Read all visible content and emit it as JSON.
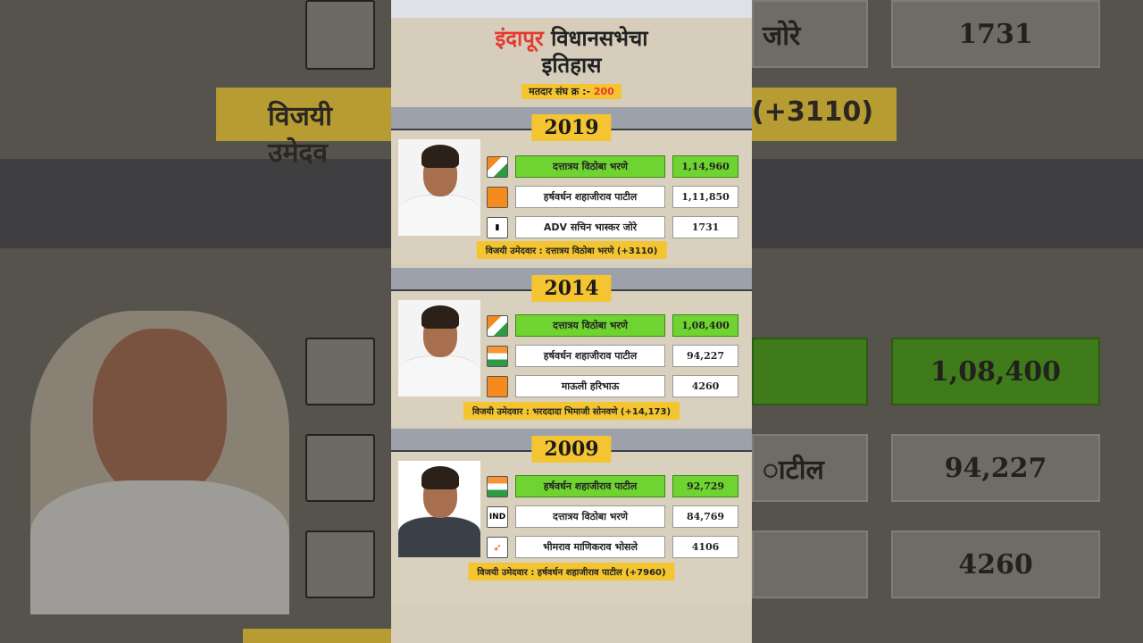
{
  "page": {
    "title_highlight": "इंदापूर",
    "title_rest": " विधानसभेचा",
    "title_line2": "इतिहास",
    "constituency_label": "मतदार संघ क्र :-",
    "constituency_number": "200"
  },
  "background": {
    "left_banner": "विजयी उमेदव",
    "right_top_name": "जोरे",
    "right_top_votes": "1731",
    "right_banner": "(+3110)",
    "right_green_votes": "1,08,400",
    "right_name_2": "ाटील",
    "right_votes_2": "94,227",
    "right_votes_3": "4260"
  },
  "elections": [
    {
      "year": "2019",
      "candidates": [
        {
          "symbol": "ncp",
          "name": "दत्तात्रय विठोबा भरणे",
          "votes": "1,14,960",
          "winner": true
        },
        {
          "symbol": "bjp",
          "name": "हर्षवर्धन शहाजीराव पाटील",
          "votes": "1,11,850",
          "winner": false
        },
        {
          "symbol": "cyl",
          "name": "ADV सचिन भास्कर जोरे",
          "votes": "1731",
          "winner": false
        }
      ],
      "winner_text": "विजयी उमेदवार : दत्तात्रय विठोबा भरणे (+3110)"
    },
    {
      "year": "2014",
      "candidates": [
        {
          "symbol": "ncp",
          "name": "दत्तात्रय विठोबा भरणे",
          "votes": "1,08,400",
          "winner": true
        },
        {
          "symbol": "inc",
          "name": "हर्षवर्धन शहाजीराव पाटील",
          "votes": "94,227",
          "winner": false
        },
        {
          "symbol": "bjp",
          "name": "माऊली हरिभाऊ",
          "votes": "4260",
          "winner": false
        }
      ],
      "winner_text": "विजयी उमेदवार : भरददादा भिमाजी सोनवणे (+14,173)"
    },
    {
      "year": "2009",
      "candidates": [
        {
          "symbol": "inc",
          "name": "हर्षवर्धन शहाजीराव पाटील",
          "votes": "92,729",
          "winner": true
        },
        {
          "symbol": "ind",
          "symbol_label": "IND",
          "name": "दत्तात्रय विठोबा भरणे",
          "votes": "84,769",
          "winner": false
        },
        {
          "symbol": "ss",
          "name": "भीमराव माणिकराव भोसले",
          "votes": "4106",
          "winner": false
        }
      ],
      "winner_text": "विजयी उमेदवार : हर्षवर्धन शहाजीराव पाटील (+7960)"
    }
  ]
}
